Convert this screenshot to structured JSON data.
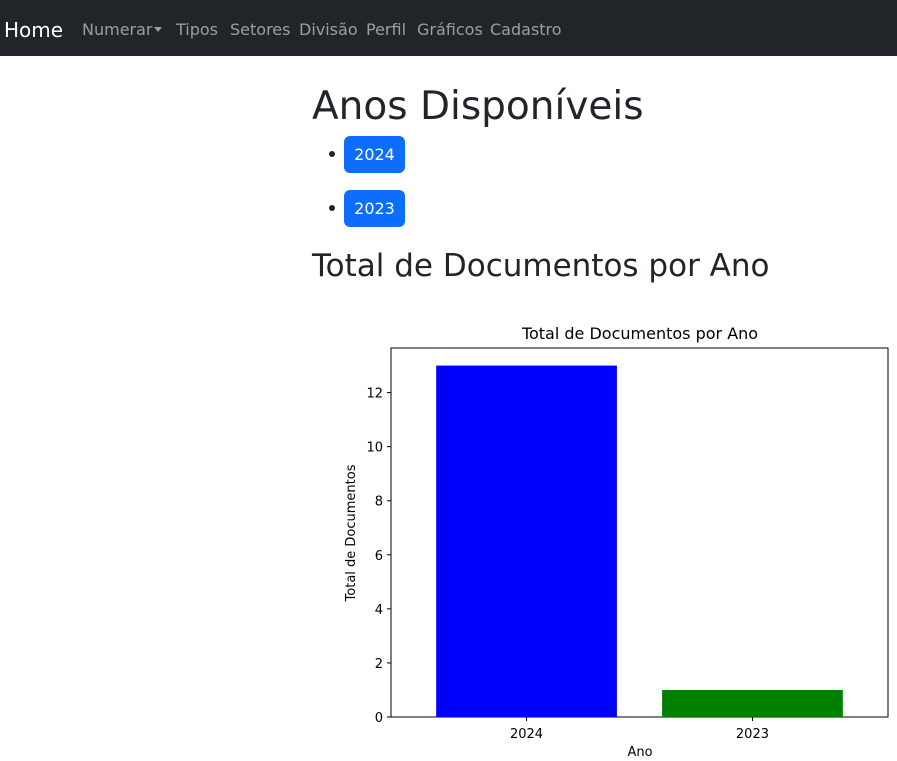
{
  "navbar": {
    "brand": "Home",
    "links": [
      "Numerar",
      "Tipos",
      "Setores",
      "Divisão",
      "Perfil",
      "Gráficos",
      "Cadastro"
    ]
  },
  "main": {
    "heading": "Anos Disponíveis",
    "years": [
      "2024",
      "2023"
    ],
    "chart_heading": "Total de Documentos por Ano"
  },
  "chart_data": {
    "type": "bar",
    "title": "Total de Documentos por Ano",
    "xlabel": "Ano",
    "ylabel": "Total de Documentos",
    "categories": [
      "2024",
      "2023"
    ],
    "values": [
      13,
      1
    ],
    "colors": [
      "#0000ff",
      "#008000"
    ],
    "ylim": [
      0,
      13.65
    ],
    "yticks": [
      0,
      2,
      4,
      6,
      8,
      10,
      12
    ],
    "grid": false
  }
}
